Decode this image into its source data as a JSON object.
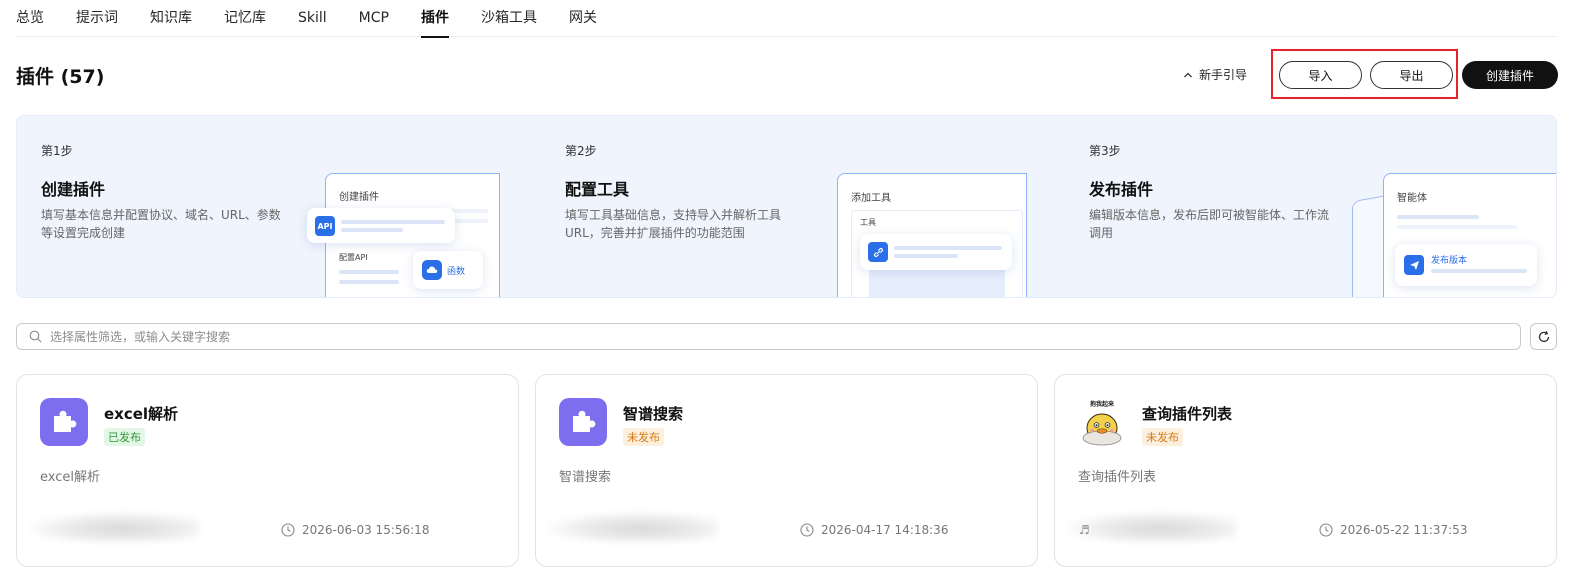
{
  "tabs": [
    "总览",
    "提示词",
    "知识库",
    "记忆库",
    "Skill",
    "MCP",
    "插件",
    "沙箱工具",
    "网关"
  ],
  "active_tab": "插件",
  "page": {
    "title": "插件 (57)",
    "guide_label": "新手引导",
    "import_label": "导入",
    "export_label": "导出",
    "create_label": "创建插件"
  },
  "steps": [
    {
      "no": "第1步",
      "title": "创建插件",
      "desc": "填写基本信息并配置协议、域名、URL、参数等设置完成创建",
      "mock_title": "创建插件",
      "chip": "API",
      "sub_label": "配置API",
      "func_label": "函数"
    },
    {
      "no": "第2步",
      "title": "配置工具",
      "desc": "填写工具基础信息，支持导入并解析工具URL，完善并扩展插件的功能范围",
      "mock_title": "添加工具",
      "sub_label": "工具"
    },
    {
      "no": "第3步",
      "title": "发布插件",
      "desc": "编辑版本信息，发布后即可被智能体、工作流调用",
      "mock_title": "智能体",
      "publish_label": "发布版本"
    }
  ],
  "search": {
    "placeholder": "选择属性筛选，或输入关键字搜索"
  },
  "cards": [
    {
      "title": "excel解析",
      "status": "已发布",
      "desc": "excel解析",
      "time": "2026-06-03 15:56:18"
    },
    {
      "title": "智谱搜索",
      "status": "未发布",
      "desc": "智谱搜索",
      "time": "2026-04-17 14:18:36"
    },
    {
      "title": "查询插件列表",
      "status": "未发布",
      "desc": "查询插件列表",
      "time": "2026-05-22 11:37:53",
      "avatar_caption": "抱我起来"
    }
  ],
  "colors": {
    "accent": "#2a6ee8",
    "plugin_icon": "#7d6ef0",
    "highlight": "#e8212b",
    "published": "#2f9a3c",
    "unpublished": "#d67b17"
  }
}
